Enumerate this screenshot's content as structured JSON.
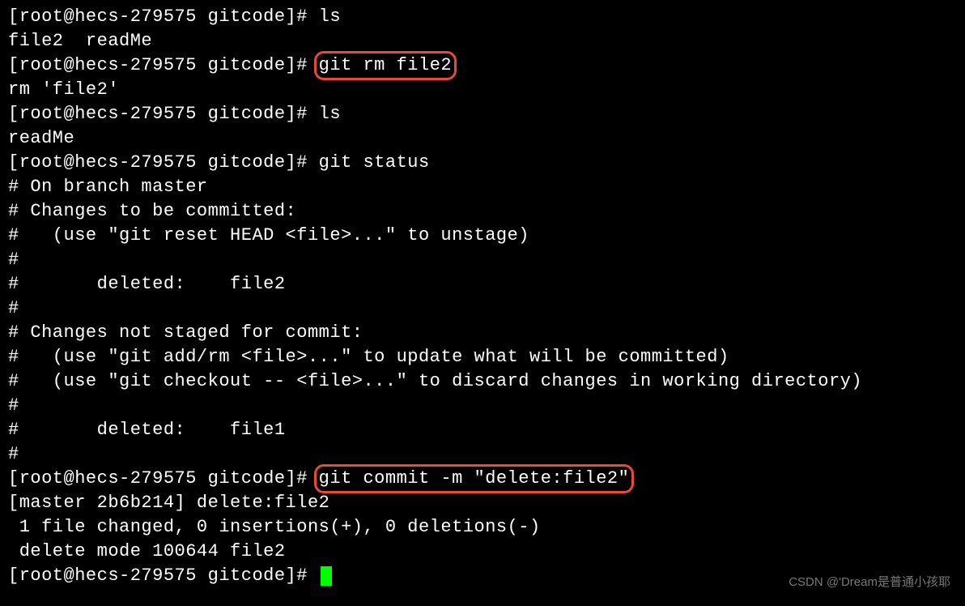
{
  "prompt": "[root@hecs-279575 gitcode]# ",
  "lines": [
    {
      "type": "cmd",
      "text": "ls",
      "hl": false
    },
    {
      "type": "out",
      "text": "file2  readMe"
    },
    {
      "type": "cmd",
      "text": "git rm file2",
      "hl": true
    },
    {
      "type": "out",
      "text": "rm 'file2'"
    },
    {
      "type": "cmd",
      "text": "ls",
      "hl": false
    },
    {
      "type": "out",
      "text": "readMe"
    },
    {
      "type": "cmd",
      "text": "git status",
      "hl": false
    },
    {
      "type": "out",
      "text": "# On branch master"
    },
    {
      "type": "out",
      "text": "# Changes to be committed:"
    },
    {
      "type": "out",
      "text": "#   (use \"git reset HEAD <file>...\" to unstage)"
    },
    {
      "type": "out",
      "text": "#"
    },
    {
      "type": "out",
      "text": "#       deleted:    file2"
    },
    {
      "type": "out",
      "text": "#"
    },
    {
      "type": "out",
      "text": "# Changes not staged for commit:"
    },
    {
      "type": "out",
      "text": "#   (use \"git add/rm <file>...\" to update what will be committed)"
    },
    {
      "type": "out",
      "text": "#   (use \"git checkout -- <file>...\" to discard changes in working directory)"
    },
    {
      "type": "out",
      "text": "#"
    },
    {
      "type": "out",
      "text": "#       deleted:    file1"
    },
    {
      "type": "out",
      "text": "#"
    },
    {
      "type": "cmd",
      "text": "git commit -m \"delete:file2\"",
      "hl": true
    },
    {
      "type": "out",
      "text": "[master 2b6b214] delete:file2"
    },
    {
      "type": "out",
      "text": " 1 file changed, 0 insertions(+), 0 deletions(-)"
    },
    {
      "type": "out",
      "text": " delete mode 100644 file2"
    },
    {
      "type": "cursor"
    }
  ],
  "watermark": "CSDN @'Dream是普通小孩耶"
}
